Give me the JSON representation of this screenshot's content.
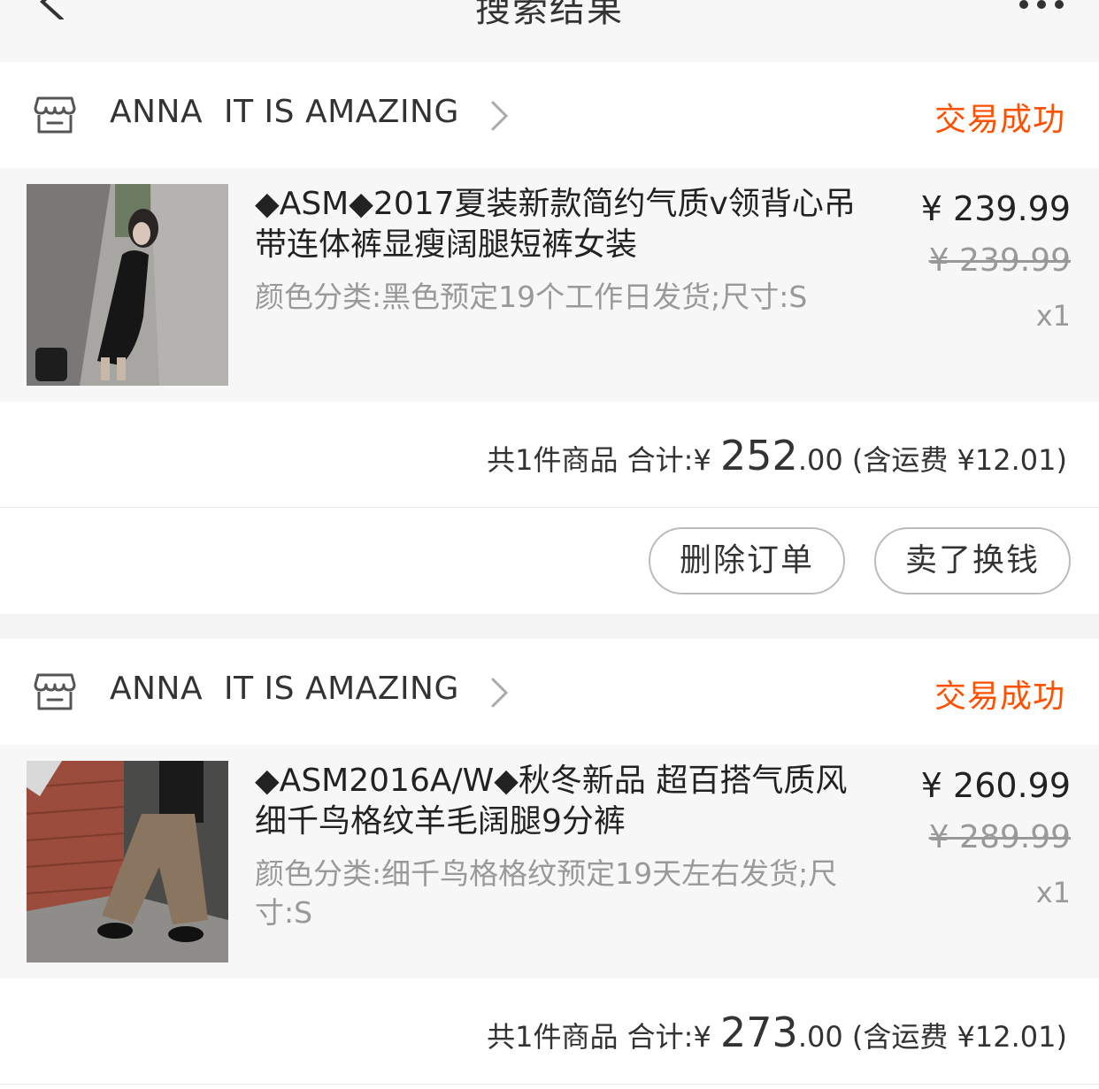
{
  "header": {
    "title": "搜索结果",
    "back_icon": "chevron-left-icon",
    "more_icon": "more-dots-icon"
  },
  "colors": {
    "accent": "#ff5000",
    "muted": "#999999",
    "background": "#f4f4f4"
  },
  "orders": [
    {
      "shop_name": "ANNA  IT IS AMAZING",
      "status": "交易成功",
      "item": {
        "title": "◆ASM◆2017夏装新款简约气质v领背心吊带连体裤显瘦阔腿短裤女装",
        "sku": "颜色分类:黑色预定19个工作日发货;尺寸:S",
        "price": "¥ 239.99",
        "original_price": "¥ 239.99",
        "quantity": "x1"
      },
      "summary": {
        "count_label": "共1件商品",
        "total_label": "合计:",
        "currency": "¥",
        "total_int": "252",
        "total_dec": ".00",
        "shipping": "(含运费 ¥12.01)"
      },
      "actions": {
        "delete_label": "删除订单",
        "sell_label": "卖了换钱"
      }
    },
    {
      "shop_name": "ANNA  IT IS AMAZING",
      "status": "交易成功",
      "item": {
        "title": "◆ASM2016A/W◆秋冬新品 超百搭气质风 细千鸟格纹羊毛阔腿9分裤",
        "sku": "颜色分类:细千鸟格格纹预定19天左右发货;尺寸:S",
        "price": "¥ 260.99",
        "original_price": "¥ 289.99",
        "quantity": "x1"
      },
      "summary": {
        "count_label": "共1件商品",
        "total_label": "合计:",
        "currency": "¥",
        "total_int": "273",
        "total_dec": ".00",
        "shipping": "(含运费 ¥12.01)"
      }
    }
  ]
}
